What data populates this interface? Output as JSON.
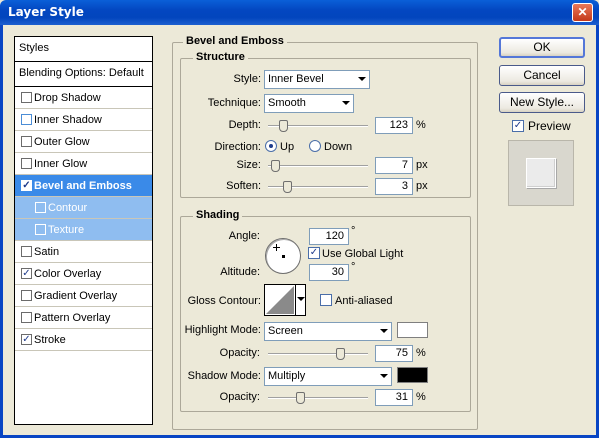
{
  "window": {
    "title": "Layer Style",
    "close_glyph": "✕"
  },
  "styles": {
    "header": "Styles",
    "blending_options": "Blending Options: Default",
    "items": [
      {
        "label": "Drop Shadow",
        "checked": false
      },
      {
        "label": "Inner Shadow",
        "checked": false
      },
      {
        "label": "Outer Glow",
        "checked": false
      },
      {
        "label": "Inner Glow",
        "checked": false
      },
      {
        "label": "Bevel and Emboss",
        "checked": true,
        "active": true
      },
      {
        "label": "Contour",
        "checked": false,
        "sub": true
      },
      {
        "label": "Texture",
        "checked": false,
        "sub": true
      },
      {
        "label": "Satin",
        "checked": false
      },
      {
        "label": "Color Overlay",
        "checked": true
      },
      {
        "label": "Gradient Overlay",
        "checked": false
      },
      {
        "label": "Pattern Overlay",
        "checked": false
      },
      {
        "label": "Stroke",
        "checked": true
      }
    ]
  },
  "bevel": {
    "group_title": "Bevel and Emboss",
    "structure": {
      "title": "Structure",
      "style_label": "Style:",
      "style_value": "Inner Bevel",
      "technique_label": "Technique:",
      "technique_value": "Smooth",
      "depth_label": "Depth:",
      "depth_value": "123",
      "depth_unit": "%",
      "depth_level": 0.12,
      "direction_label": "Direction:",
      "dir_up": "Up",
      "dir_down": "Down",
      "direction": "Up",
      "size_label": "Size:",
      "size_value": "7",
      "size_unit": "px",
      "size_level": 0.03,
      "soften_label": "Soften:",
      "soften_value": "3",
      "soften_unit": "px",
      "soften_level": 0.17
    },
    "shading": {
      "title": "Shading",
      "angle_label": "Angle:",
      "angle_value": "120",
      "angle_unit": "°",
      "global_light_label": "Use Global Light",
      "global_light": true,
      "altitude_label": "Altitude:",
      "altitude_value": "30",
      "altitude_unit": "°",
      "gloss_label": "Gloss Contour:",
      "antialiased_label": "Anti-aliased",
      "antialiased": false,
      "highlight_label": "Highlight Mode:",
      "highlight_value": "Screen",
      "highlight_color": "#ffffff",
      "highlight_opacity_label": "Opacity:",
      "highlight_opacity": "75",
      "highlight_opacity_unit": "%",
      "highlight_level": 0.75,
      "shadow_label": "Shadow Mode:",
      "shadow_value": "Multiply",
      "shadow_color": "#000000",
      "shadow_opacity_label": "Opacity:",
      "shadow_opacity": "31",
      "shadow_opacity_unit": "%",
      "shadow_level": 0.31
    }
  },
  "buttons": {
    "ok": "OK",
    "cancel": "Cancel",
    "new_style": "New Style...",
    "preview_label": "Preview",
    "preview": true
  }
}
